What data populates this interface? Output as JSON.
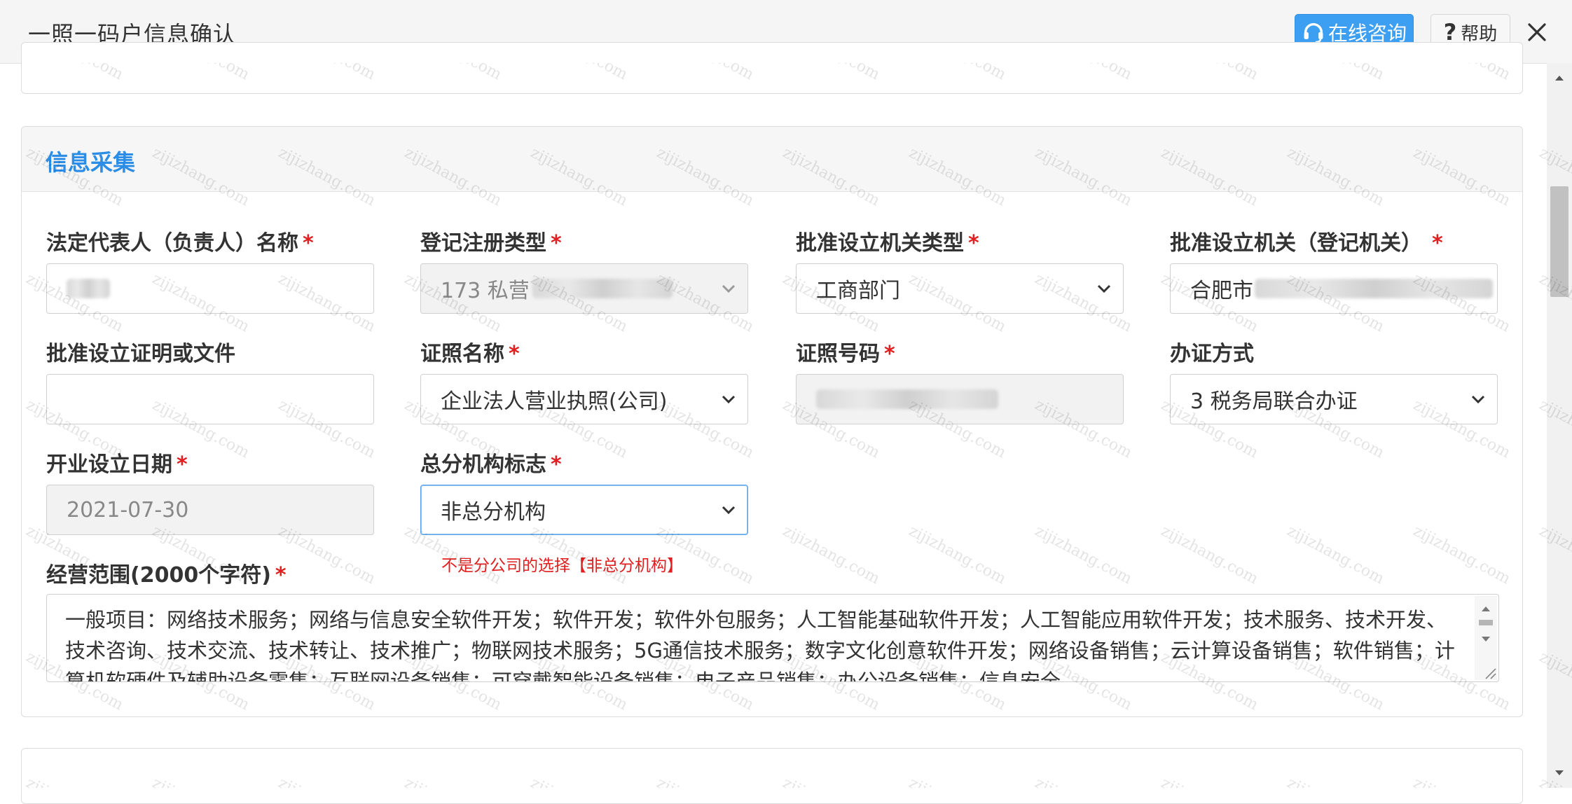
{
  "window": {
    "title": "一照一码户信息确认",
    "consult_label": "在线咨询",
    "help_label": "帮助"
  },
  "section": {
    "title": "信息采集"
  },
  "fields": {
    "legal_rep": {
      "label": "法定代表人（负责人）名称",
      "value": "",
      "required": true
    },
    "reg_type": {
      "label": "登记注册类型",
      "value": "173 私营",
      "required": true
    },
    "approval_authority_type": {
      "label": "批准设立机关类型",
      "value": "工商部门",
      "required": true
    },
    "approval_authority": {
      "label": "批准设立机关（登记机关）",
      "value": "合肥市",
      "required": true
    },
    "approval_doc": {
      "label": "批准设立证明或文件",
      "value": "",
      "required": false
    },
    "license_name": {
      "label": "证照名称",
      "value": "企业法人营业执照(公司)",
      "required": true
    },
    "license_number": {
      "label": "证照号码",
      "value": "",
      "required": true
    },
    "handling_method": {
      "label": "办证方式",
      "value": "3 税务局联合办证",
      "required": false
    },
    "open_date": {
      "label": "开业设立日期",
      "value": "2021-07-30",
      "required": true
    },
    "branch_flag": {
      "label": "总分机构标志",
      "value": "非总分机构",
      "required": true,
      "hint": "不是分公司的选择【非总分机构】"
    },
    "business_scope": {
      "label": "经营范围(2000个字符)",
      "required": true,
      "value": "一般项目：网络技术服务；网络与信息安全软件开发；软件开发；软件外包服务；人工智能基础软件开发；人工智能应用软件开发；技术服务、技术开发、技术咨询、技术交流、技术转让、技术推广；物联网技术服务；5G通信技术服务；数字文化创意软件开发；网络设备销售；云计算设备销售；软件销售；计算机软硬件及辅助设备零售；互联网设备销售；可穿戴智能设备销售；电子产品销售；办公设备销售；信息安全"
    }
  },
  "required_mark": "*",
  "watermark_text": "zijizhang.com",
  "colors": {
    "accent": "#2c8de6",
    "consult_bg": "#3d9ff2",
    "required": "#e02020"
  }
}
